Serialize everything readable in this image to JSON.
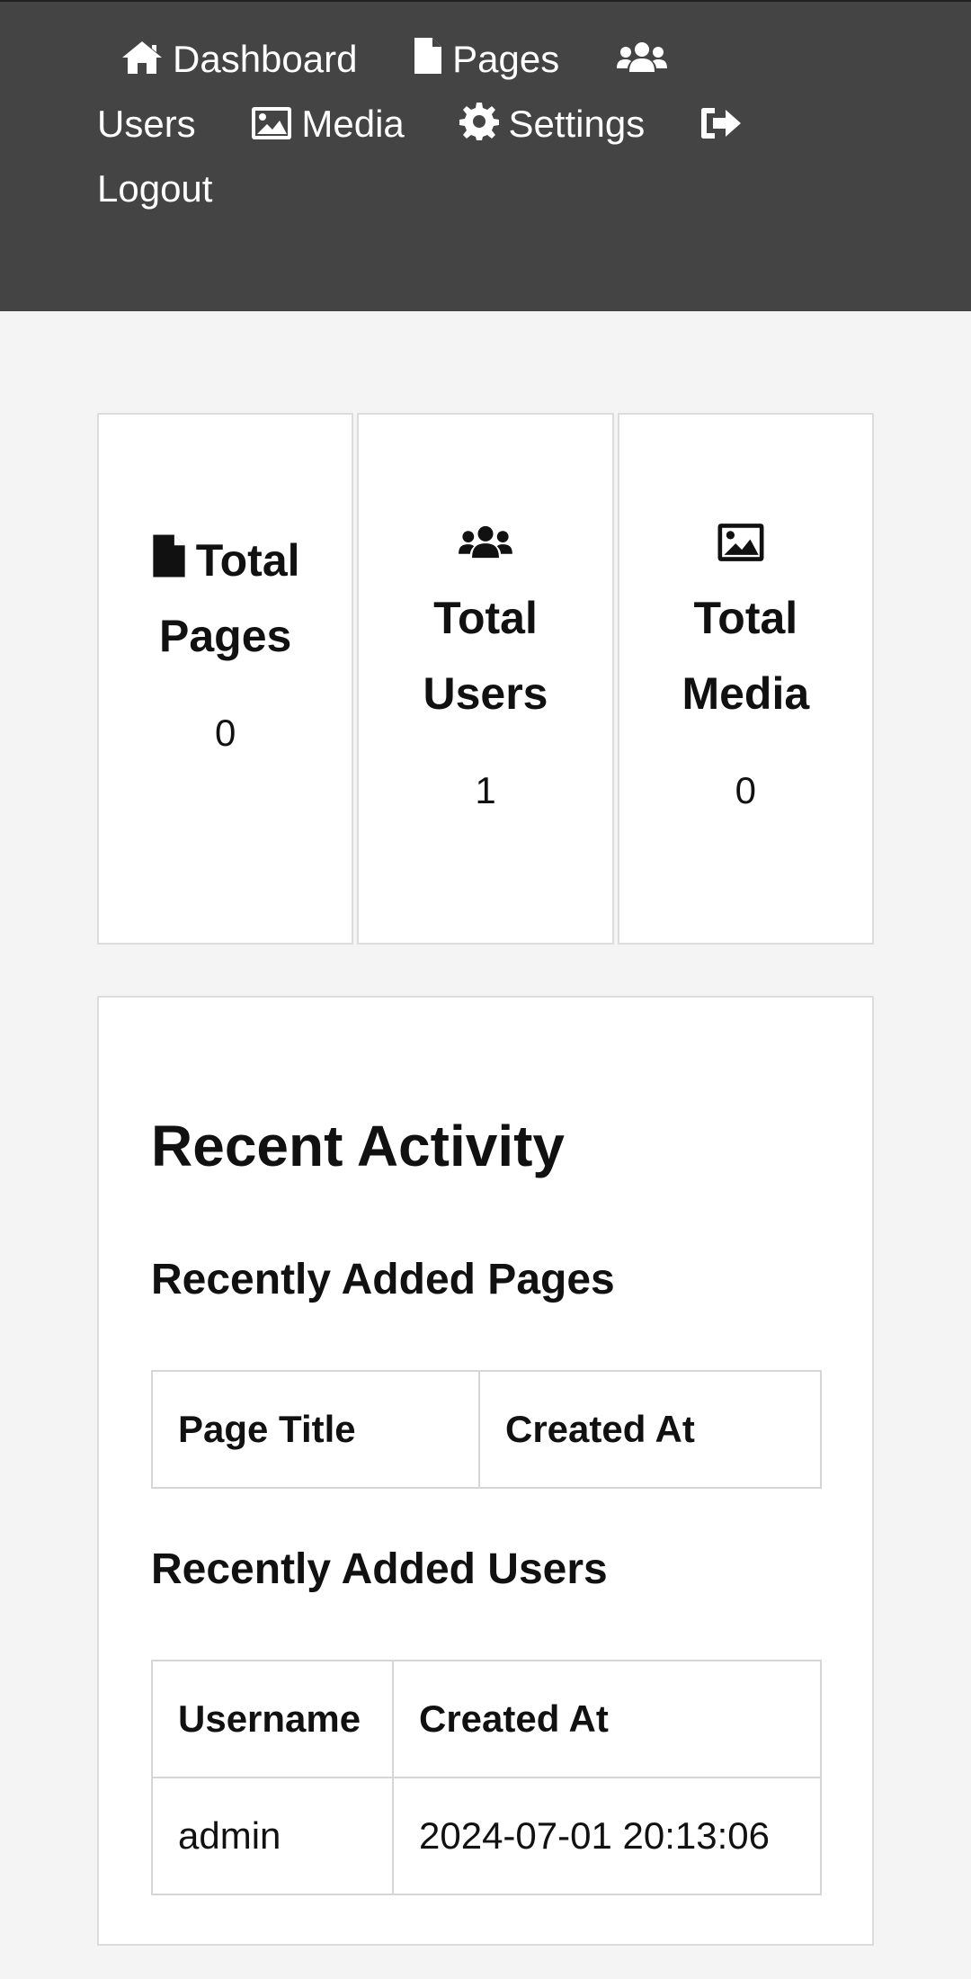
{
  "nav": {
    "items": [
      {
        "label": "Dashboard",
        "icon": "home-icon"
      },
      {
        "label": "Pages",
        "icon": "file-icon"
      },
      {
        "label": "Users",
        "icon": "users-icon"
      },
      {
        "label": "Media",
        "icon": "image-icon"
      },
      {
        "label": "Settings",
        "icon": "gear-icon"
      },
      {
        "label": "Logout",
        "icon": "logout-icon"
      }
    ]
  },
  "stats": [
    {
      "title_line1": "Total",
      "title_line2": "Pages",
      "value": "0",
      "icon": "file-icon"
    },
    {
      "title_line1": "Total",
      "title_line2": "Users",
      "value": "1",
      "icon": "users-icon"
    },
    {
      "title_line1": "Total",
      "title_line2": "Media",
      "value": "0",
      "icon": "image-icon"
    }
  ],
  "activity": {
    "title": "Recent Activity",
    "pages_heading": "Recently Added Pages",
    "pages_table": {
      "headers": [
        "Page Title",
        "Created At"
      ],
      "rows": []
    },
    "users_heading": "Recently Added Users",
    "users_table": {
      "headers": [
        "Username",
        "Created At"
      ],
      "rows": [
        [
          "admin",
          "2024-07-01 20:13:06"
        ]
      ]
    }
  },
  "colors": {
    "nav_bg": "#444444",
    "page_bg": "#f4f4f4",
    "card_border": "#dcdcdc"
  }
}
